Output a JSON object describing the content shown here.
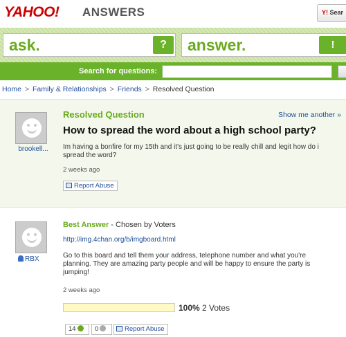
{
  "header": {
    "logo": "YAHOO!",
    "section": "ANSWERS",
    "search_button": "Sear"
  },
  "band": {
    "ask": "ask.",
    "ask_icon": "?",
    "answer": "answer.",
    "answer_icon": "!"
  },
  "search": {
    "label": "Search for questions:",
    "value": ""
  },
  "breadcrumb": {
    "items": [
      "Home",
      "Family & Relationships",
      "Friends"
    ],
    "current": "Resolved Question",
    "separator": ">"
  },
  "question": {
    "status": "Resolved Question",
    "show_another": "Show me another »",
    "title": "How to spread the word about a high school party?",
    "body": "Im having a bonfire for my 15th and it's just going to be really chill and legit how do i spread the word?",
    "asker": "brookell...",
    "time": "2 weeks ago",
    "report": "Report Abuse"
  },
  "answer": {
    "label": "Best Answer",
    "chosen_by": " - Chosen by Voters",
    "link": "http://img.4chan.org/b/imgboard.html",
    "body": "Go to this board and tell them your address, telephone number and what you're planning. They are amazing party people and will be happy to ensure the party is jumping!",
    "user": "RBX",
    "time": "2 weeks ago",
    "vote_percent": "100%",
    "vote_count": "2 Votes",
    "vote_fraction": 1.0,
    "thumbs_up": "14",
    "thumbs_down": "0",
    "report": "Report Abuse"
  },
  "colors": {
    "brand_red": "#cc0000",
    "accent_green": "#6aaa1e",
    "link_blue": "#1f4f99"
  }
}
